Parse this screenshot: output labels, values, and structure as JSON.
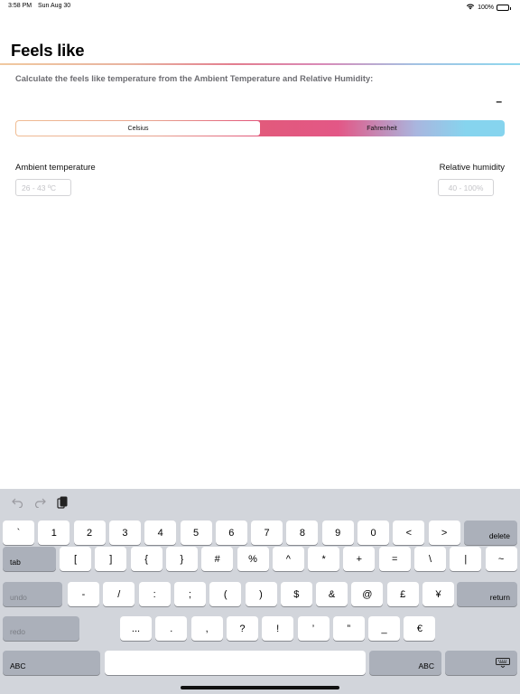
{
  "status": {
    "time": "3:58 PM",
    "date": "Sun Aug 30",
    "battery": "100%"
  },
  "page": {
    "title": "Feels like",
    "description": "Calculate the feels like temperature from the Ambient Temperature and Relative Humidity:",
    "result": "–"
  },
  "units": {
    "celsius": "Celsius",
    "fahrenheit": "Fahrenheit",
    "selected": "Celsius"
  },
  "fields": {
    "ambient_label": "Ambient temperature",
    "ambient_placeholder": "26 - 43 ºC",
    "humidity_label": "Relative humidity",
    "humidity_placeholder": "40 - 100%"
  },
  "keyboard": {
    "row1": [
      "`",
      "1",
      "2",
      "3",
      "4",
      "5",
      "6",
      "7",
      "8",
      "9",
      "0",
      "<",
      ">"
    ],
    "row2": [
      "[",
      "]",
      "{",
      "}",
      "#",
      "%",
      "^",
      "*",
      "+",
      "=",
      "\\",
      "|",
      "~"
    ],
    "row3": [
      "-",
      "/",
      ":",
      ";",
      "(",
      ")",
      "$",
      "&",
      "@",
      "£",
      "¥"
    ],
    "row4": [
      "...",
      ".",
      ",",
      "?",
      "!",
      "’",
      "”",
      "_",
      "€"
    ],
    "delete": "delete",
    "tab": "tab",
    "undo": "undo",
    "return": "return",
    "redo": "redo",
    "abc_left": "ABC",
    "abc_right": "ABC"
  }
}
